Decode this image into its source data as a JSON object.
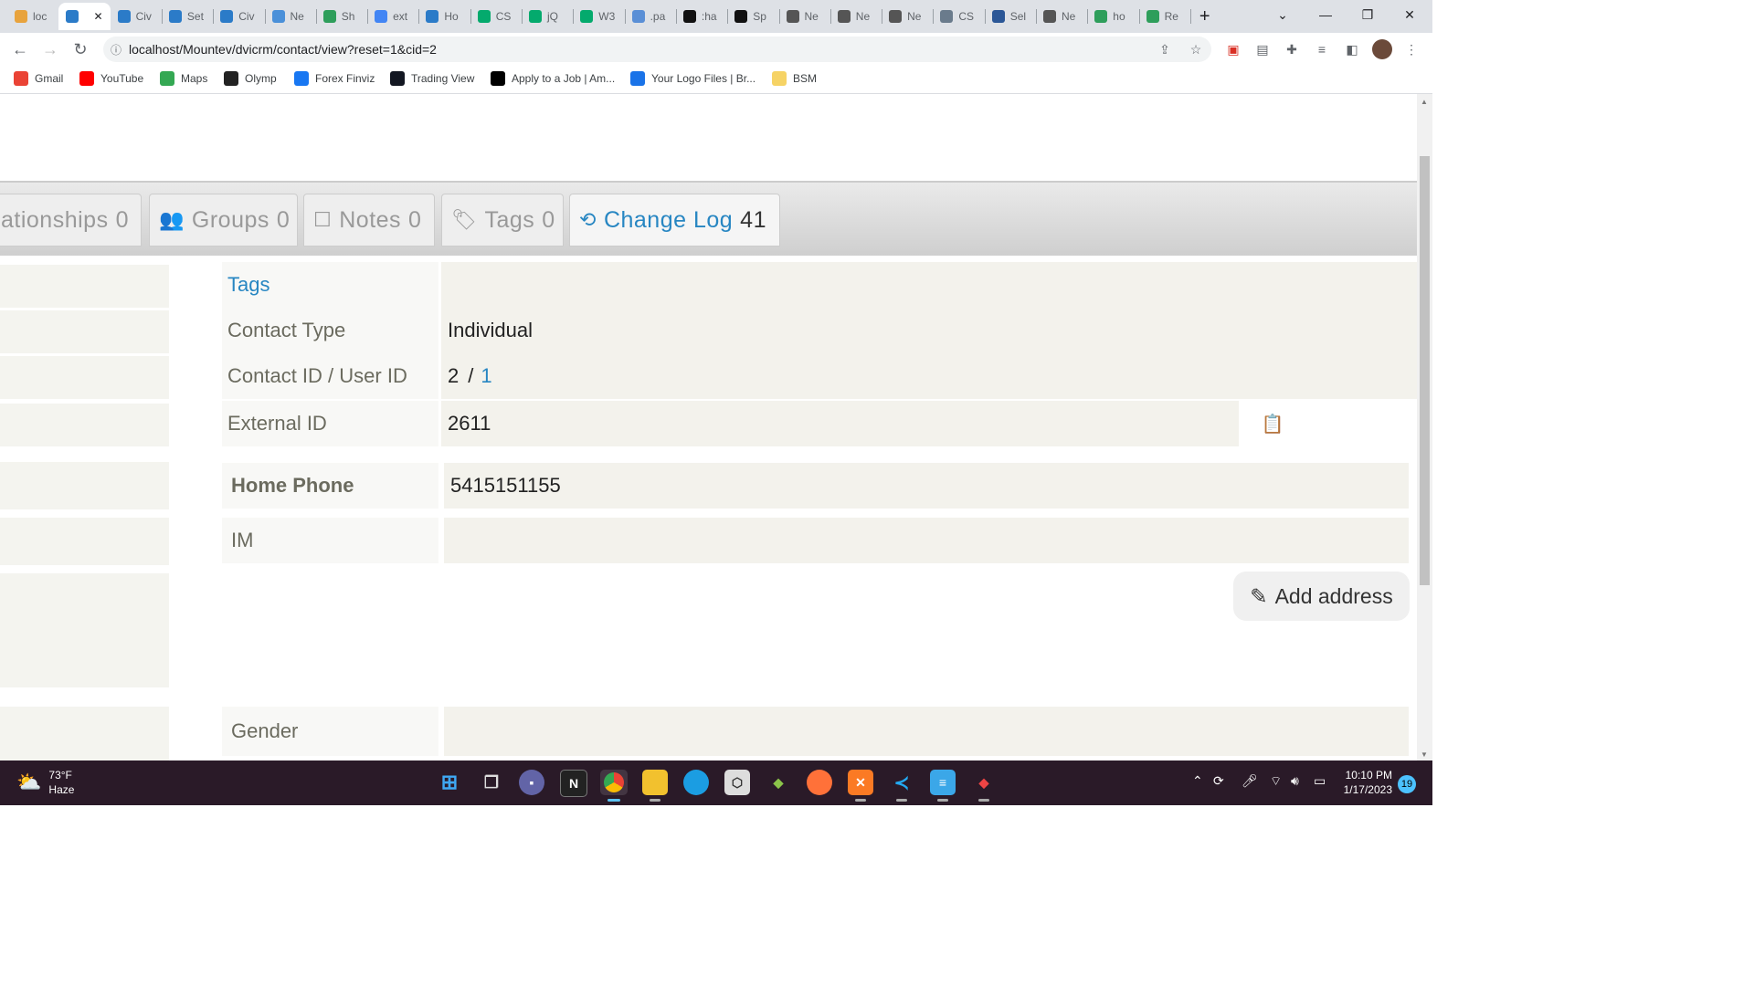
{
  "browser": {
    "tabs": [
      {
        "label": "loc",
        "color": "#e8a33d"
      },
      {
        "label": "",
        "color": "#2b7bc8",
        "active": true
      },
      {
        "label": "Civ",
        "color": "#2b7bc8"
      },
      {
        "label": "Set",
        "color": "#2b7bc8"
      },
      {
        "label": "Civ",
        "color": "#2b7bc8"
      },
      {
        "label": "Ne",
        "color": "#4a90d9"
      },
      {
        "label": "Sh",
        "color": "#2e9e5b"
      },
      {
        "label": "ext",
        "color": "#4285f4"
      },
      {
        "label": "Ho",
        "color": "#2b7bc8"
      },
      {
        "label": "CS",
        "color": "#04aa6d"
      },
      {
        "label": "jQ",
        "color": "#04aa6d"
      },
      {
        "label": "W3",
        "color": "#04aa6d"
      },
      {
        "label": ".pa",
        "color": "#5a8fd6"
      },
      {
        "label": ":ha",
        "color": "#111111"
      },
      {
        "label": "Sp",
        "color": "#111111"
      },
      {
        "label": "Ne",
        "color": "#555555"
      },
      {
        "label": "Ne",
        "color": "#555555"
      },
      {
        "label": "Ne",
        "color": "#555555"
      },
      {
        "label": "CS",
        "color": "#6a7b8c"
      },
      {
        "label": "Sel",
        "color": "#2b5797"
      },
      {
        "label": "Ne",
        "color": "#555555"
      },
      {
        "label": "ho",
        "color": "#2e9e5b"
      },
      {
        "label": "Re",
        "color": "#2e9e5b"
      }
    ],
    "tab_close": "✕",
    "new_tab": "+",
    "url": "localhost/Mountev/dvicrm/contact/view?reset=1&cid=2",
    "bookmarks": [
      {
        "label": "Gmail",
        "color": "#ea4335"
      },
      {
        "label": "YouTube",
        "color": "#ff0000"
      },
      {
        "label": "Maps",
        "color": "#34a853"
      },
      {
        "label": "Olymp",
        "color": "#222222"
      },
      {
        "label": "Forex Finviz",
        "color": "#1877f2"
      },
      {
        "label": "Trading View",
        "color": "#131722"
      },
      {
        "label": "Apply to a Job | Am...",
        "color": "#000000"
      },
      {
        "label": "Your Logo Files | Br...",
        "color": "#1a73e8"
      },
      {
        "label": "BSM",
        "color": "#f6d365"
      }
    ]
  },
  "contact_tabs": [
    {
      "label": "ationships",
      "count": "0",
      "icon": "relationships-icon"
    },
    {
      "label": "Groups",
      "count": "0",
      "icon": "groups-icon",
      "glyph": "👥"
    },
    {
      "label": "Notes",
      "count": "0",
      "icon": "notes-icon",
      "glyph": "☐"
    },
    {
      "label": "Tags",
      "count": "0",
      "icon": "tags-icon",
      "glyph": "🏷"
    },
    {
      "label": "Change Log",
      "count": "41",
      "icon": "history-icon",
      "glyph": "⟲",
      "active": true
    }
  ],
  "summary": {
    "tags_label": "Tags",
    "tags_value": "",
    "contact_type_label": "Contact Type",
    "contact_type_value": "Individual",
    "contact_id_label": "Contact ID / User ID",
    "contact_id_value": "2",
    "id_separator": "/",
    "user_id_value": "1",
    "external_id_label": "External ID",
    "external_id_value": "2611",
    "copy_icon": "📋"
  },
  "communication": {
    "home_phone_label": "Home Phone",
    "home_phone_value": "5415151155",
    "im_label": "IM",
    "im_value": ""
  },
  "address": {
    "add_label": "Add address",
    "pencil_glyph": "✎"
  },
  "demographics": {
    "gender_label": "Gender",
    "gender_value": ""
  },
  "taskbar": {
    "weather_temp": "73°F",
    "weather_desc": "Haze",
    "time": "10:10 PM",
    "date": "1/17/2023",
    "notification_count": "19"
  }
}
